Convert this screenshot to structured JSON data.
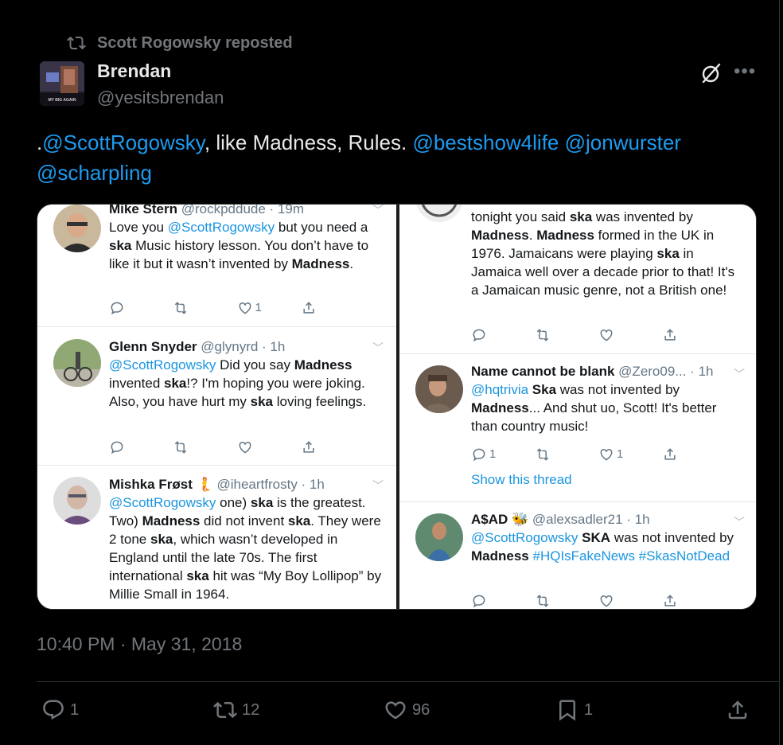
{
  "repost": {
    "text": "Scott Rogowsky reposted"
  },
  "author": {
    "name": "Brendan",
    "handle": "@yesitsbrendan",
    "avatar_caption": "MY BIG AGAIN"
  },
  "tweet": {
    "prefix": ".",
    "mention1": "@ScottRogowsky",
    "middle": ", like Madness, Rules. ",
    "mention2": "@bestshow4life",
    "space": " ",
    "mention3": "@jonwurster",
    "mention4": "@scharpling"
  },
  "media": {
    "left": [
      {
        "name": "Mike Stern",
        "handle": "@rockpddude · 19m",
        "text": [
          "Love you ",
          "@ScottRogowsky",
          " but you need a ",
          "ska",
          " Music history lesson. You don’t have to like it but it wasn’t invented by ",
          "Madness",
          "."
        ],
        "likes": "1"
      },
      {
        "name": "Glenn Snyder",
        "handle": "@glynyrd · 1h",
        "text": [
          "@ScottRogowsky",
          " Did you say ",
          "Madness",
          " invented ",
          "ska",
          "!?  I'm hoping you were joking. Also, you have hurt my ",
          "ska",
          " loving feelings."
        ]
      },
      {
        "name": "Mishka Frøst",
        "handle": "@iheartfrosty · 1h",
        "text": [
          "@ScottRogowsky",
          " one) ",
          "ska",
          " is the greatest. Two) ",
          "Madness",
          " did not invent ",
          "ska",
          ". They were 2 tone ",
          "ska",
          ", which wasn’t developed in England until the late 70s. The first international ",
          "ska",
          " hit was “My Boy Lollipop” by Millie Small in 1964."
        ]
      }
    ],
    "right": [
      {
        "text": [
          "tonight you said ",
          "ska",
          " was invented by ",
          "Madness",
          ". ",
          "Madness",
          " formed in the UK in 1976. Jamaicans were playing ",
          "ska",
          " in Jamaica well over a decade prior to that! It's a Jamaican music genre, not a British one!"
        ]
      },
      {
        "name": "Name cannot be blank",
        "handle": "@Zero09... · 1h",
        "text": [
          "@hqtrivia",
          " ",
          "Ska",
          " was not invented by ",
          "Madness",
          "... And shut uo, Scott! It's better than country music!"
        ],
        "replies": "1",
        "likes": "1",
        "show_thread": "Show this thread"
      },
      {
        "name": "A$AD",
        "handle": "@alexsadler21 · 1h",
        "text": [
          "@ScottRogowsky",
          " ",
          "SKA",
          " was not invented by ",
          "Madness",
          " ",
          "#HQIsFakeNews",
          " ",
          "#SkasNotDead"
        ]
      }
    ]
  },
  "timestamp": "10:40 PM · May 31, 2018",
  "actions": {
    "replies": "1",
    "reposts": "12",
    "likes": "96",
    "bookmarks": "1"
  }
}
